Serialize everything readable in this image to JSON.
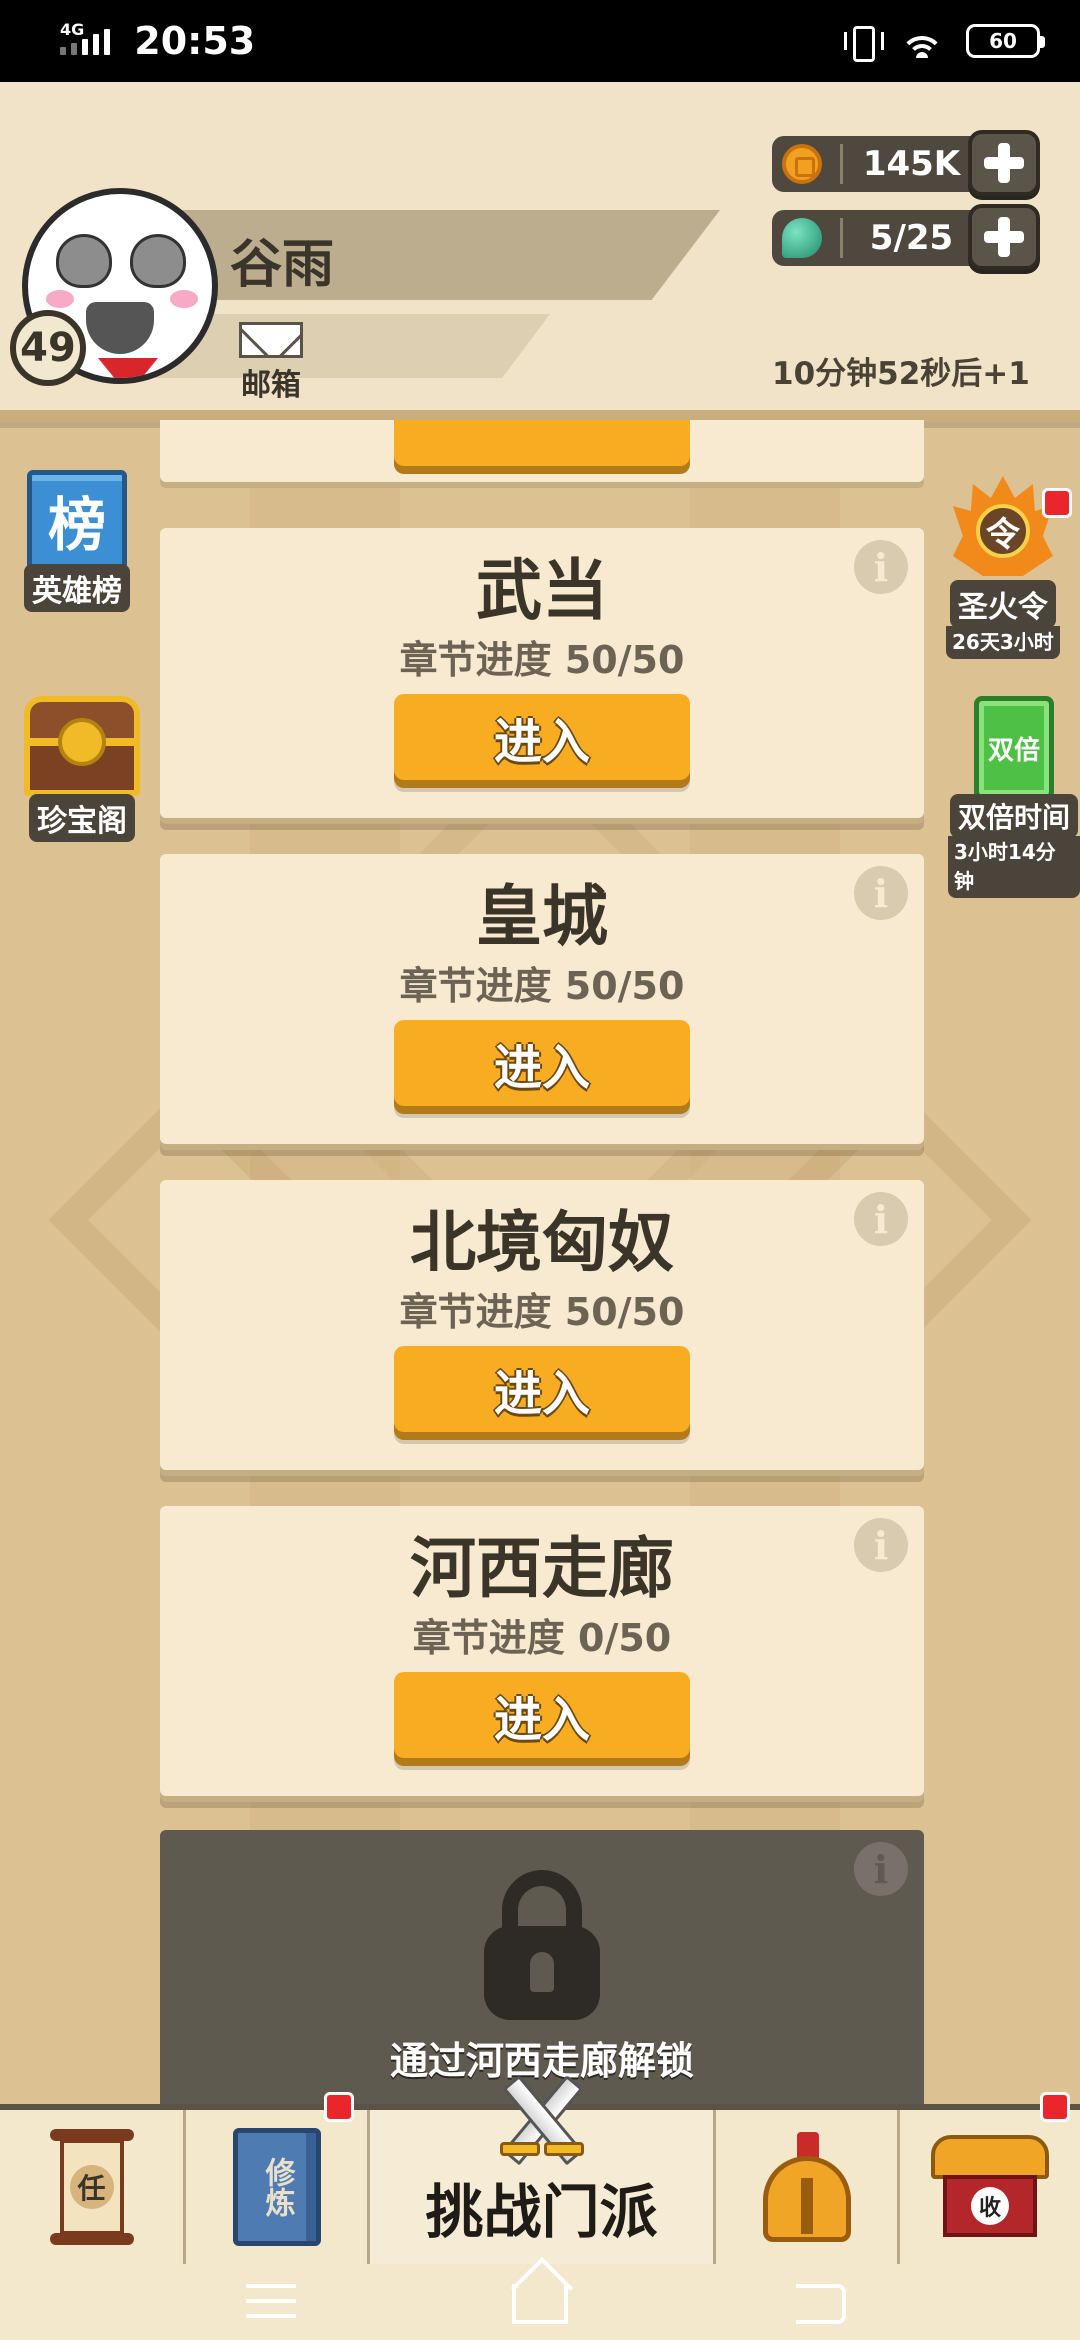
{
  "status_bar": {
    "network": "4G",
    "time": "20:53",
    "battery": "60"
  },
  "header": {
    "player_name": "谷雨",
    "level": "49",
    "mail_label": "邮箱",
    "coins": "145K",
    "stamina": "5/25",
    "regen_timer": "10分钟52秒后+1"
  },
  "side_left": [
    {
      "icon_text": "榜",
      "label": "英雄榜"
    },
    {
      "label": "珍宝阁"
    }
  ],
  "side_right": [
    {
      "icon_text": "令",
      "label": "圣火令",
      "sub": "26天3小时"
    },
    {
      "icon_text": "双倍",
      "label": "双倍时间",
      "sub": "3小时14分钟"
    }
  ],
  "stages": [
    {
      "name": "武当",
      "progress": "章节进度 50/50",
      "button": "进入"
    },
    {
      "name": "皇城",
      "progress": "章节进度 50/50",
      "button": "进入"
    },
    {
      "name": "北境匈奴",
      "progress": "章节进度 50/50",
      "button": "进入"
    },
    {
      "name": "河西走廊",
      "progress": "章节进度 0/50",
      "button": "进入"
    }
  ],
  "info_glyph": "i",
  "locked_stage": {
    "unlock_text": "通过河西走廊解锁"
  },
  "bottom_nav": {
    "tasks_icon_text": "任",
    "train_icon_text": "修炼",
    "challenge_label": "挑战门派",
    "shop_icon_text": "收"
  },
  "colors": {
    "accent_button": "#f8ac22",
    "card_bg": "#f7ead0",
    "page_bg": "#dcc193",
    "notification_dot": "#e8262b"
  }
}
